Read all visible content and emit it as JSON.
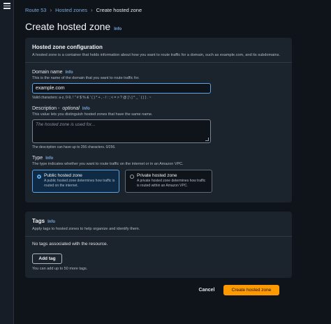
{
  "breadcrumb": {
    "items": [
      "Route 53",
      "Hosted zones"
    ],
    "current": "Create hosted zone"
  },
  "page": {
    "title": "Create hosted zone",
    "info": "Info"
  },
  "config": {
    "title": "Hosted zone configuration",
    "description": "A hosted zone is a container that holds information about how you want to route traffic for a domain, such as example.com, and its subdomains.",
    "domain": {
      "label": "Domain name",
      "info": "Info",
      "hint": "This is the name of the domain that you want to route traffic for.",
      "value": "example.com",
      "constraint": "Valid characters: a-z, 0-9, ! \" # $ % & ' ( ) * + , - / : ; < = > ? @ [ \\ ] ^ _ ` { | } . ~"
    },
    "description_field": {
      "label": "Description -",
      "optional": "optional",
      "info": "Info",
      "hint": "This value lets you distinguish hosted zones that have the same name.",
      "placeholder": "The hosted zone is used for...",
      "constraint": "The description can have up to 256 characters. 0/256."
    },
    "type": {
      "label": "Type",
      "info": "Info",
      "hint": "The type indicates whether you want to route traffic on the internet or in an Amazon VPC.",
      "options": [
        {
          "title": "Public hosted zone",
          "desc": "A public hosted zone determines how traffic is routed on the internet.",
          "selected": true
        },
        {
          "title": "Private hosted zone",
          "desc": "A private hosted zone determines how traffic is routed within an Amazon VPC.",
          "selected": false
        }
      ]
    }
  },
  "tags": {
    "title": "Tags",
    "info": "Info",
    "description": "Apply tags to hosted zones to help organize and identify them.",
    "empty": "No tags associated with the resource.",
    "add_label": "Add tag",
    "add_hint": "You can add up to 50 more tags."
  },
  "actions": {
    "cancel": "Cancel",
    "create": "Create hosted zone"
  },
  "colors": {
    "accent": "#5ba6e8",
    "primary_button": "#ff9900",
    "link": "#7aa7d8"
  }
}
